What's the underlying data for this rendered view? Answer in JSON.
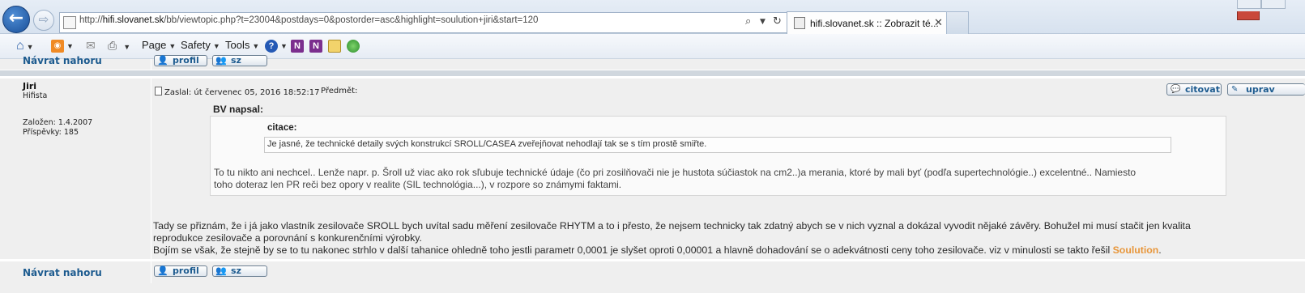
{
  "browser": {
    "url": "http://hifi.slovanet.sk/bb/viewtopic.php?t=23004&postdays=0&postorder=asc&highlight=soulution+jiri&start=120",
    "url_domain": "hifi.slovanet.sk",
    "url_prefix": "http://",
    "url_suffix": "/bb/viewtopic.php?t=23004&postdays=0&postorder=asc&highlight=soulution+jiri&start=120",
    "tab_title": "hifi.slovanet.sk :: Zobrazit té...",
    "tab_close": "✕"
  },
  "toolbar": {
    "page_label": "Page",
    "safety_label": "Safety",
    "tools_label": "Tools"
  },
  "forum": {
    "back_to_top": "Návrat nahoru",
    "profile_btn": "profil",
    "pm_btn": "sz",
    "post": {
      "author": "Jiri",
      "rank": "Hifista",
      "joined": "Založen: 1.4.2007",
      "posts": "Příspěvky: 185",
      "posted": "Zaslal: út červenec 05, 2016 18:52:17",
      "subject_label": "Předmět:",
      "quote_btn": "citovat",
      "edit_btn": "uprav",
      "quote_author": "BV napsal:",
      "nested_quote_label": "citace:",
      "nested_quote_text": "Je jasné, že technické detaily svých konstrukcí SROLL/CASEA zveřejňovat nehodlají tak se s tím prostě smiřte.",
      "quote_text_line1": "To tu nikto ani nechcel.. Lenže napr. p. Šroll už viac ako rok sľubuje technické údaje (čo pri zosilňovači nie je hustota súčiastok na cm2..)a merania, ktoré by mali byť (podľa supertechnológie..) excelentné.. Namiesto",
      "quote_text_line2": "toho doteraz len PR reči bez opory v realite (SIL technológia...), v rozpore so známymi faktami.",
      "body_line1": "Tady se přiznám, že i já jako vlastník zesilovače SROLL bych uvítal sadu měření zesilovače RHYTM a to i přesto, že nejsem technicky tak zdatný abych se v nich vyznal a dokázal vyvodit nějaké závěry. Bohužel mi musí stačit jen kvalita",
      "body_line2": "reprodukce zesilovače a porovnání s konkurenčními výrobky.",
      "body_line3": "Bojím se však, že stejně by se to tu nakonec strhlo v další tahanice ohledně toho jestli parametr 0,0001 je slyšet oproti 0,00001 a hlavně dohadování se o adekvátnosti ceny toho zesilovače. viz v minulosti se takto řešil",
      "highlight": "Soulution",
      "body_end": "."
    }
  },
  "colors": {
    "link": "#1d5b8f",
    "highlight": "#e8963a",
    "panel": "#efefef"
  }
}
